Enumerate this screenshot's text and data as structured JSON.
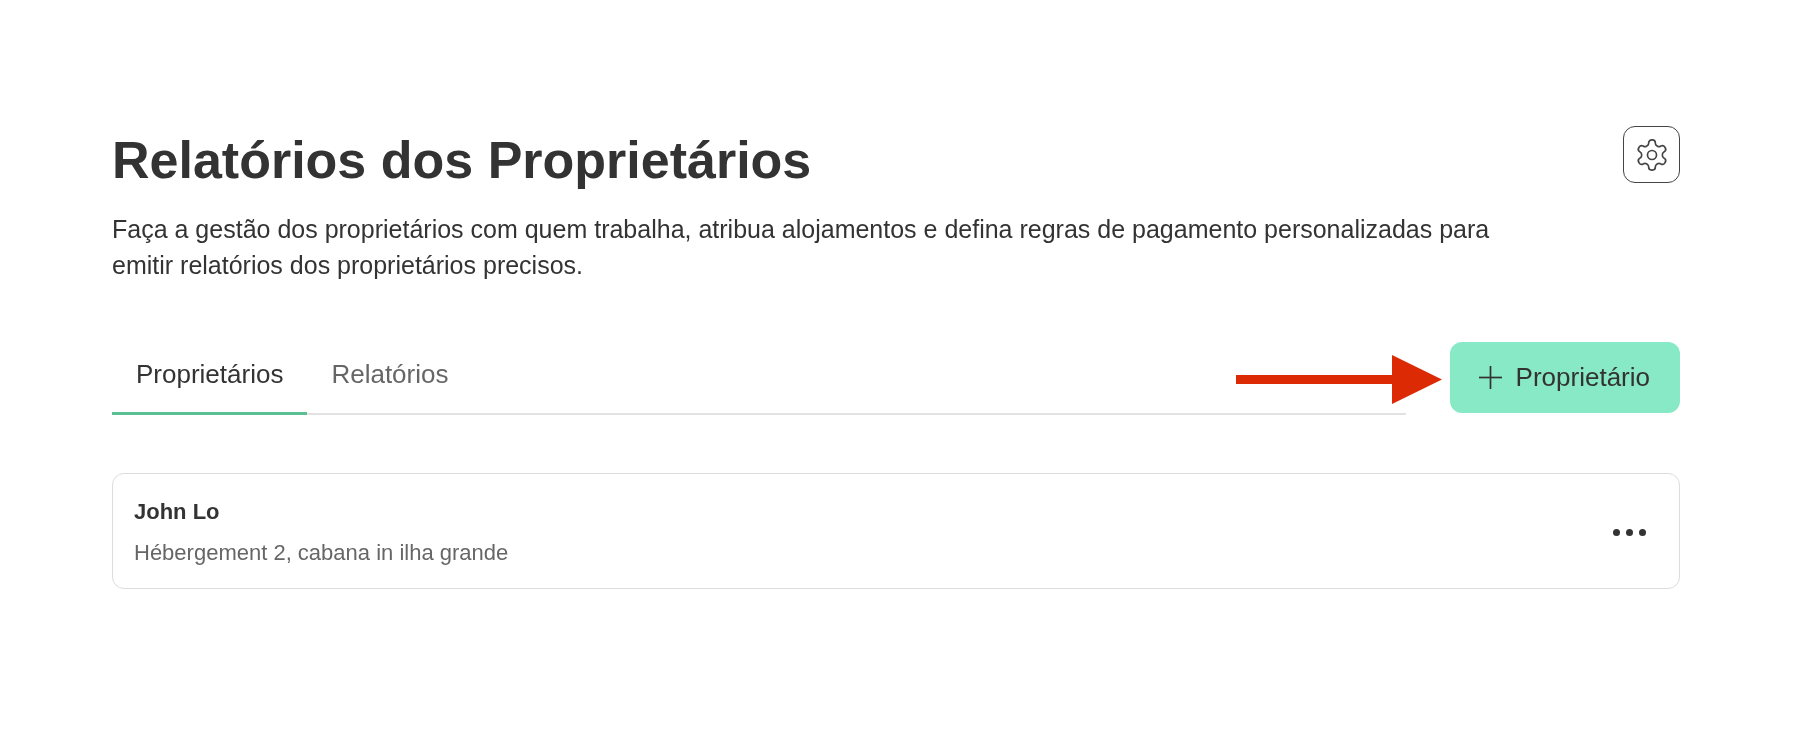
{
  "page": {
    "title": "Relatórios dos Proprietários",
    "description": "Faça a gestão dos proprietários com quem trabalha, atribua alojamentos e defina regras de pagamento personalizadas para emitir relatórios dos proprietários precisos."
  },
  "tabs": [
    {
      "label": "Proprietários",
      "selected": true
    },
    {
      "label": "Relatórios",
      "selected": false
    }
  ],
  "add_button": {
    "label": "Proprietário"
  },
  "owners": [
    {
      "name": "John Lo",
      "properties": "Hébergement 2, cabana in ilha grande"
    }
  ]
}
